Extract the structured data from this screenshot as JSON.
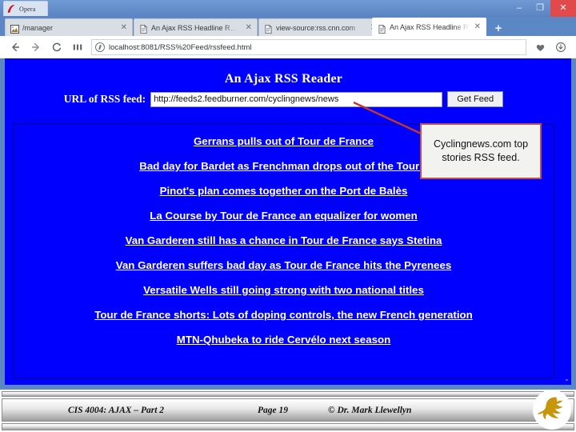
{
  "window": {
    "app_chip_label": "Opera",
    "controls": {
      "minimize": "–",
      "maximize": "❐",
      "close": "✕"
    }
  },
  "tabs": [
    {
      "title": "/manager",
      "close": "✕",
      "favicon": "image-icon",
      "active": false
    },
    {
      "title": "An Ajax RSS Headline R…",
      "close": "✕",
      "favicon": "page-icon",
      "active": false
    },
    {
      "title": "view-source:rss.cnn.com",
      "close": "✕",
      "favicon": "page-icon",
      "active": false
    },
    {
      "title": "An Ajax RSS Headline R…",
      "close": "✕",
      "favicon": "page-icon",
      "active": true
    }
  ],
  "new_tab_label": "+",
  "navbar": {
    "back": "←",
    "forward": "→",
    "reload": "C",
    "sidebar": "❙❙❙",
    "address": "localhost:8081/RSS%20Feed/rssfeed.html",
    "heart": "♥",
    "download": "↓"
  },
  "page": {
    "heading": "An Ajax RSS Reader",
    "form": {
      "label": "URL of RSS feed:",
      "url_value": "http://feeds2.feedburner.com/cyclingnews/news",
      "url_placeholder": "http://",
      "button_label": "Get Feed"
    },
    "headlines": [
      "Gerrans pulls out of Tour de France",
      "Bad day for Bardet as Frenchman drops out of the Tour's",
      "Pinot's plan comes together on the Port de Balès",
      "La Course by Tour de France an equalizer for women",
      "Van Garderen still has a chance in Tour de France says Stetina",
      "Van Garderen suffers bad day as Tour de France hits the Pyrenees",
      "Versatile Wells still going strong with two national titles",
      "Tour de France shorts: Lots of doping controls, the new French generation",
      "MTN-Qhubeka to ride Cervélo next season"
    ],
    "scroll_arrow": "⌄"
  },
  "callout": {
    "text": "Cyclingnews.com top stories RSS feed.",
    "border_color": "#c0504d",
    "arrow_color": "#c0392b"
  },
  "footer": {
    "course": "CIS 4004: AJAX – Part 2",
    "page": "Page 19",
    "copyright": "© Dr. Mark Llewellyn",
    "logo": "ucf-pegasus-logo"
  },
  "colors": {
    "page_background": "#0000ff",
    "chrome_blue": "#5b88c4",
    "close_red": "#e04a4a",
    "logo_gold": "#c8960c"
  }
}
